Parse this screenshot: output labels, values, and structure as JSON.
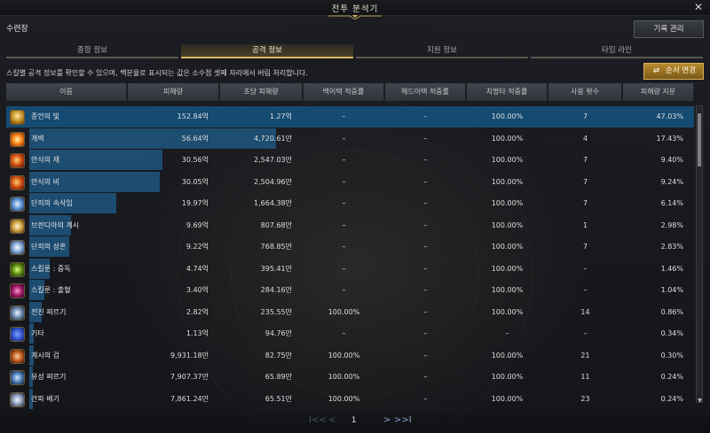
{
  "window": {
    "title": "전투 분석기",
    "close_label": "✕"
  },
  "header": {
    "character": "수련장",
    "record_button": "기록 관리"
  },
  "tabs": [
    {
      "label": "종합 정보",
      "active": false
    },
    {
      "label": "공격 정보",
      "active": true
    },
    {
      "label": "지원 정보",
      "active": false
    },
    {
      "label": "타임 라인",
      "active": false
    }
  ],
  "description": "스킬별 공격 정보를 확인할 수 있으며, 백분율로 표시되는 값은 소수점 셋째 자리에서 버림 처리합니다.",
  "order_button": {
    "label": "순서 변경",
    "icon": "swap-icon"
  },
  "columns": [
    "이름",
    "피해량",
    "초당 피해량",
    "백어택 적중률",
    "헤드어택 적중률",
    "치명타 적중률",
    "사용 횟수",
    "피해량 지분"
  ],
  "rows": [
    {
      "icon": "skill-icon-gold",
      "name": "종언의 빛",
      "damage": "152.84억",
      "dps": "1.27억",
      "back": "–",
      "head": "–",
      "crit": "100.00%",
      "uses": "7",
      "share": "47.03%",
      "share_value": 47.03,
      "selected": true
    },
    {
      "icon": "skill-icon-orange",
      "name": "개벽",
      "damage": "56.64억",
      "dps": "4,720.61만",
      "back": "–",
      "head": "–",
      "crit": "100.00%",
      "uses": "4",
      "share": "17.43%",
      "share_value": 17.43,
      "selected": false
    },
    {
      "icon": "skill-icon-fire",
      "name": "안식의 재",
      "damage": "30.56억",
      "dps": "2,547.03만",
      "back": "–",
      "head": "–",
      "crit": "100.00%",
      "uses": "7",
      "share": "9.40%",
      "share_value": 9.4,
      "selected": false
    },
    {
      "icon": "skill-icon-fire",
      "name": "안식의 비",
      "damage": "30.05억",
      "dps": "2,504.96만",
      "back": "–",
      "head": "–",
      "crit": "100.00%",
      "uses": "7",
      "share": "9.24%",
      "share_value": 9.24,
      "selected": false
    },
    {
      "icon": "skill-icon-blue",
      "name": "단죄의 속삭임",
      "damage": "19.97억",
      "dps": "1,664.38만",
      "back": "–",
      "head": "–",
      "crit": "100.00%",
      "uses": "7",
      "share": "6.14%",
      "share_value": 6.14,
      "selected": false
    },
    {
      "icon": "skill-icon-cross",
      "name": "브란디아의 계시",
      "damage": "9.69억",
      "dps": "807.68만",
      "back": "–",
      "head": "–",
      "crit": "100.00%",
      "uses": "1",
      "share": "2.98%",
      "share_value": 2.98,
      "selected": false
    },
    {
      "icon": "skill-icon-star",
      "name": "단죄의 성흔",
      "damage": "9.22억",
      "dps": "768.85만",
      "back": "–",
      "head": "–",
      "crit": "100.00%",
      "uses": "7",
      "share": "2.83%",
      "share_value": 2.83,
      "selected": false
    },
    {
      "icon": "skill-icon-poison",
      "name": "스킬룬 : 중독",
      "damage": "4.74억",
      "dps": "395.41만",
      "back": "–",
      "head": "–",
      "crit": "100.00%",
      "uses": "–",
      "share": "1.46%",
      "share_value": 1.46,
      "selected": false
    },
    {
      "icon": "skill-icon-bleed",
      "name": "스킬룬 : 출혈",
      "damage": "3.40억",
      "dps": "284.16만",
      "back": "–",
      "head": "–",
      "crit": "100.00%",
      "uses": "–",
      "share": "1.04%",
      "share_value": 1.04,
      "selected": false
    },
    {
      "icon": "skill-icon-spear",
      "name": "전진 찌르기",
      "damage": "2.82억",
      "dps": "235.55만",
      "back": "100.00%",
      "head": "–",
      "crit": "100.00%",
      "uses": "14",
      "share": "0.86%",
      "share_value": 0.86,
      "selected": false
    },
    {
      "icon": "skill-icon-etc",
      "name": "기타",
      "damage": "1.13억",
      "dps": "94.76만",
      "back": "–",
      "head": "–",
      "crit": "–",
      "uses": "–",
      "share": "0.34%",
      "share_value": 0.34,
      "selected": false
    },
    {
      "icon": "skill-icon-sword",
      "name": "계시의 검",
      "damage": "9,931.18만",
      "dps": "82.75만",
      "back": "100.00%",
      "head": "–",
      "crit": "100.00%",
      "uses": "21",
      "share": "0.30%",
      "share_value": 0.3,
      "selected": false
    },
    {
      "icon": "skill-icon-meteor",
      "name": "유성 찌르기",
      "damage": "7,907.37만",
      "dps": "65.89만",
      "back": "100.00%",
      "head": "–",
      "crit": "100.00%",
      "uses": "11",
      "share": "0.24%",
      "share_value": 0.24,
      "selected": false
    },
    {
      "icon": "skill-icon-slash",
      "name": "간파 베기",
      "damage": "7,861.24만",
      "dps": "65.51만",
      "back": "100.00%",
      "head": "–",
      "crit": "100.00%",
      "uses": "23",
      "share": "0.24%",
      "share_value": 0.24,
      "selected": false
    }
  ],
  "pager": {
    "first": "I<<",
    "prev": "<",
    "current": "1",
    "next": ">",
    "last": ">>I"
  },
  "colors": {
    "accent_gold": "#d9b860",
    "bar_blue": "#1e5680",
    "selected_row": "#154a72"
  }
}
